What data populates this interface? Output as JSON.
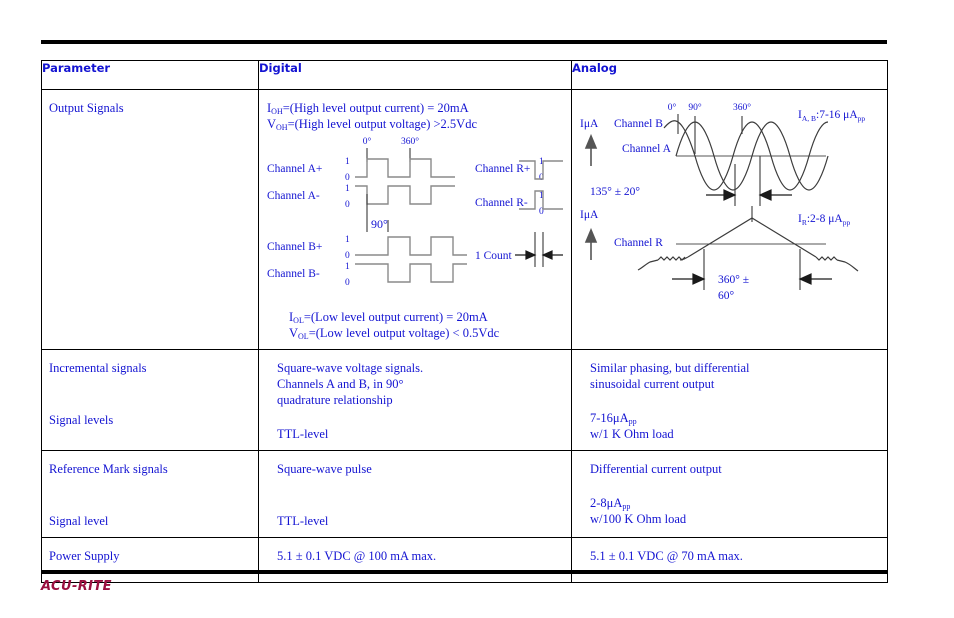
{
  "footer": {
    "logo": "ACU-RITE"
  },
  "table": {
    "headers": {
      "parameter": "Parameter",
      "digital": "Digital",
      "analog": "Analog"
    },
    "rows": [
      {
        "parameter": "Output Signals",
        "digital": {
          "top_line1_a": "I",
          "top_line1_sub": "OH",
          "top_line1_b": "=(High level output current) = 20mA",
          "top_line2_a": "V",
          "top_line2_sub": "OH",
          "top_line2_b": "=(High level output voltage) >2.5Vdc",
          "bottom_line1_a": "I",
          "bottom_line1_sub": "OL",
          "bottom_line1_b": "=(Low level output current) = 20mA",
          "bottom_line2_a": "V",
          "bottom_line2_sub": "OL",
          "bottom_line2_b": "=(Low level output voltage) < 0.5Vdc",
          "diagram": {
            "ch_a_plus": "Channel A+",
            "ch_a_minus": "Channel A-",
            "ch_b_plus": "Channel B+",
            "ch_b_minus": "Channel B-",
            "ch_r_plus": "Channel R+",
            "ch_r_minus": "Channel R-",
            "deg_0": "0°",
            "deg_90": "90°",
            "deg_360": "360°",
            "one_count": "1 Count",
            "high": "1",
            "low": "0"
          }
        },
        "analog": {
          "diagram": {
            "axis_label_top": "IμA",
            "axis_label_bottom": "IμA",
            "ch_b": "Channel B",
            "ch_a": "Channel A",
            "ch_r": "Channel R",
            "deg_0": "0°",
            "deg_90": "90°",
            "deg_360": "360°",
            "phase_note": "135° ± 20°",
            "ref_width_line1": "360° ±",
            "ref_width_line2": "60°",
            "amp_ab_a": "I",
            "amp_ab_sub": "A, B",
            "amp_ab_b": ":7-16 μA",
            "amp_ab_pp": "pp",
            "amp_r_a": "I",
            "amp_r_sub": "R",
            "amp_r_b": ":2-8 μA",
            "amp_r_pp": "pp"
          }
        }
      },
      {
        "parameter_1": "Incremental signals",
        "parameter_2": "Signal levels",
        "digital_1a": "Square-wave voltage signals.",
        "digital_1b": "Channels A and B, in 90°",
        "digital_1c": "quadrature relationship",
        "digital_2": "TTL-level",
        "analog_1a": "Similar phasing, but differential",
        "analog_1b": "sinusoidal current output",
        "analog_2a": "7-16μA",
        "analog_2a_sub": "pp",
        "analog_2b": "w/1 K Ohm load"
      },
      {
        "parameter_1": "Reference Mark signals",
        "parameter_2": "Signal level",
        "digital_1": "Square-wave pulse",
        "digital_2": "TTL-level",
        "analog_1": "Differential current output",
        "analog_2a": "2-8μA",
        "analog_2a_sub": "pp",
        "analog_2b": "w/100 K Ohm load"
      },
      {
        "parameter": "Power Supply",
        "digital": "5.1 ± 0.1 VDC @ 100 mA max.",
        "analog": "5.1 ± 0.1 VDC @ 70 mA max."
      }
    ]
  },
  "colors": {
    "text_blue": "#1414d2",
    "logo_crimson": "#9b1040",
    "rule_black": "#000000",
    "waveform_gray": "#8a8a8a"
  }
}
